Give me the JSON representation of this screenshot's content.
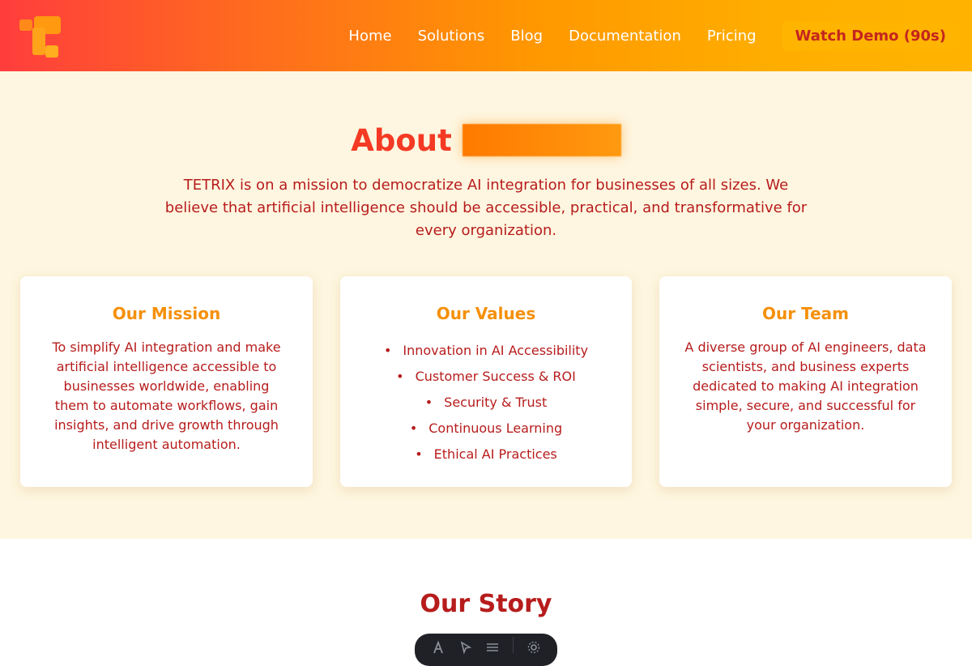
{
  "header": {
    "logo_icon": "tetrix-logo-icon",
    "nav": [
      {
        "label": "Home"
      },
      {
        "label": "Solutions"
      },
      {
        "label": "Blog"
      },
      {
        "label": "Documentation"
      },
      {
        "label": "Pricing"
      }
    ],
    "cta_label": "Watch Demo (90s)"
  },
  "about": {
    "title": "About",
    "intro": "TETRIX is on a mission to democratize AI integration for businesses of all sizes. We believe that artificial intelligence should be accessible, practical, and transformative for every organization.",
    "cards": [
      {
        "title": "Our Mission",
        "text": "To simplify AI integration and make artificial intelligence accessible to businesses worldwide, enabling them to automate workflows, gain insights, and drive growth through intelligent automation."
      },
      {
        "title": "Our Values",
        "items": [
          "Innovation in AI Accessibility",
          "Customer Success & ROI",
          "Security & Trust",
          "Continuous Learning",
          "Ethical AI Practices"
        ]
      },
      {
        "title": "Our Team",
        "text": "A diverse group of AI engineers, data scientists, and business experts dedicated to making AI integration simple, secure, and successful for your organization."
      }
    ]
  },
  "story": {
    "title": "Our Story",
    "toolbar_icons": [
      "text-icon",
      "pointer-icon",
      "menu-icon",
      "settings-icon"
    ]
  },
  "colors": {
    "accent_red": "#f43a24",
    "accent_orange": "#f5900a",
    "text_red": "#b71c1c",
    "section_bg": "#fef6e0"
  }
}
